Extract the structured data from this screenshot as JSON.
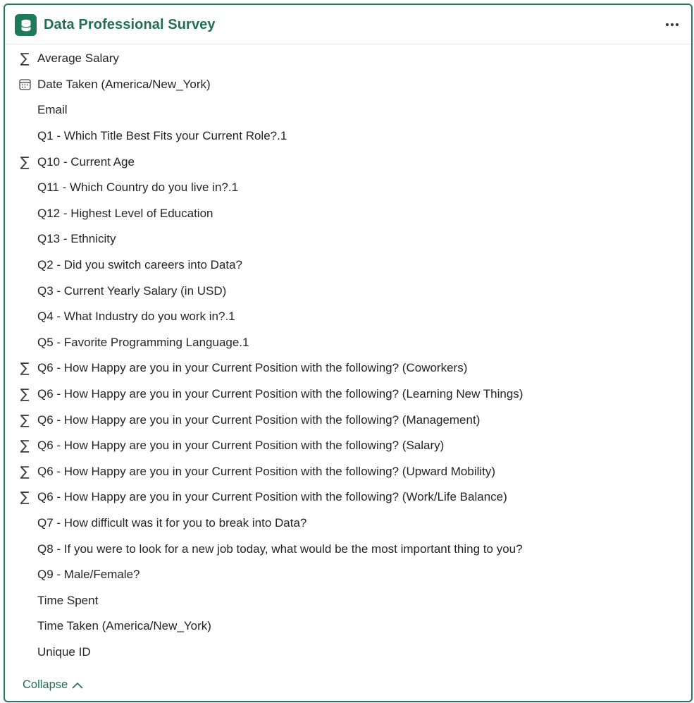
{
  "header": {
    "icon": "database-icon",
    "title": "Data Professional Survey",
    "more_icon": "more-options-icon"
  },
  "fields": [
    {
      "label": "Average Salary",
      "icon": "sigma"
    },
    {
      "label": "Date Taken (America/New_York)",
      "icon": "calendar"
    },
    {
      "label": "Email",
      "icon": ""
    },
    {
      "label": "Q1 - Which Title Best Fits your Current Role?.1",
      "icon": ""
    },
    {
      "label": "Q10 - Current Age",
      "icon": "sigma"
    },
    {
      "label": "Q11 - Which Country do you live in?.1",
      "icon": ""
    },
    {
      "label": "Q12 - Highest Level of Education",
      "icon": ""
    },
    {
      "label": "Q13 - Ethnicity",
      "icon": ""
    },
    {
      "label": "Q2 - Did you switch careers into Data?",
      "icon": ""
    },
    {
      "label": "Q3 - Current Yearly Salary (in USD)",
      "icon": ""
    },
    {
      "label": "Q4 - What Industry do you work in?.1",
      "icon": ""
    },
    {
      "label": "Q5 - Favorite Programming Language.1",
      "icon": ""
    },
    {
      "label": "Q6 - How Happy are you in your Current Position with the following? (Coworkers)",
      "icon": "sigma"
    },
    {
      "label": "Q6 - How Happy are you in your Current Position with the following? (Learning New Things)",
      "icon": "sigma"
    },
    {
      "label": "Q6 - How Happy are you in your Current Position with the following? (Management)",
      "icon": "sigma"
    },
    {
      "label": "Q6 - How Happy are you in your Current Position with the following? (Salary)",
      "icon": "sigma"
    },
    {
      "label": "Q6 - How Happy are you in your Current Position with the following? (Upward Mobility)",
      "icon": "sigma"
    },
    {
      "label": "Q6 - How Happy are you in your Current Position with the following? (Work/Life Balance)",
      "icon": "sigma"
    },
    {
      "label": "Q7 - How difficult was it for you to break into Data?",
      "icon": ""
    },
    {
      "label": "Q8 - If you were to look for a new job today, what would be the most important thing to you?",
      "icon": ""
    },
    {
      "label": "Q9 - Male/Female?",
      "icon": ""
    },
    {
      "label": "Time Spent",
      "icon": ""
    },
    {
      "label": "Time Taken (America/New_York)",
      "icon": ""
    },
    {
      "label": "Unique ID",
      "icon": ""
    }
  ],
  "footer": {
    "collapse_label": "Collapse",
    "collapse_icon": "chevron-up-icon"
  },
  "colors": {
    "accent": "#1f6f54",
    "border": "#237b5c"
  }
}
